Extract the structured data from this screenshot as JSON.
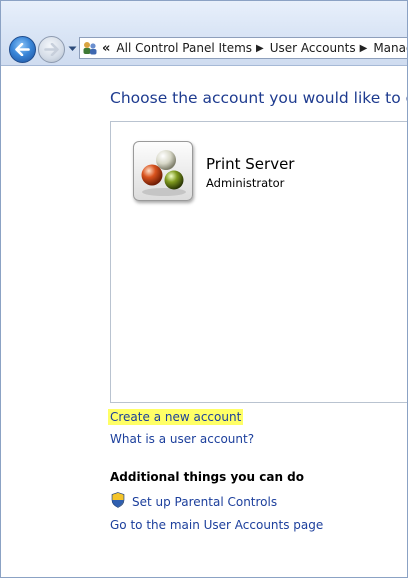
{
  "address_bar": {
    "crumbs": [
      "All Control Panel Items",
      "User Accounts",
      "Manage"
    ]
  },
  "main": {
    "heading": "Choose the account you would like to change",
    "account": {
      "name": "Print Server",
      "role": "Administrator"
    },
    "links": {
      "create_account": "Create a new account",
      "what_is_account": "What is a user account?"
    },
    "additional": {
      "title": "Additional things you can do",
      "parental_controls": "Set up Parental Controls",
      "main_page": "Go to the main User Accounts page"
    }
  },
  "colors": {
    "link": "#1c3f9c",
    "heading": "#1e3b8f",
    "highlight": "#ffff66"
  }
}
